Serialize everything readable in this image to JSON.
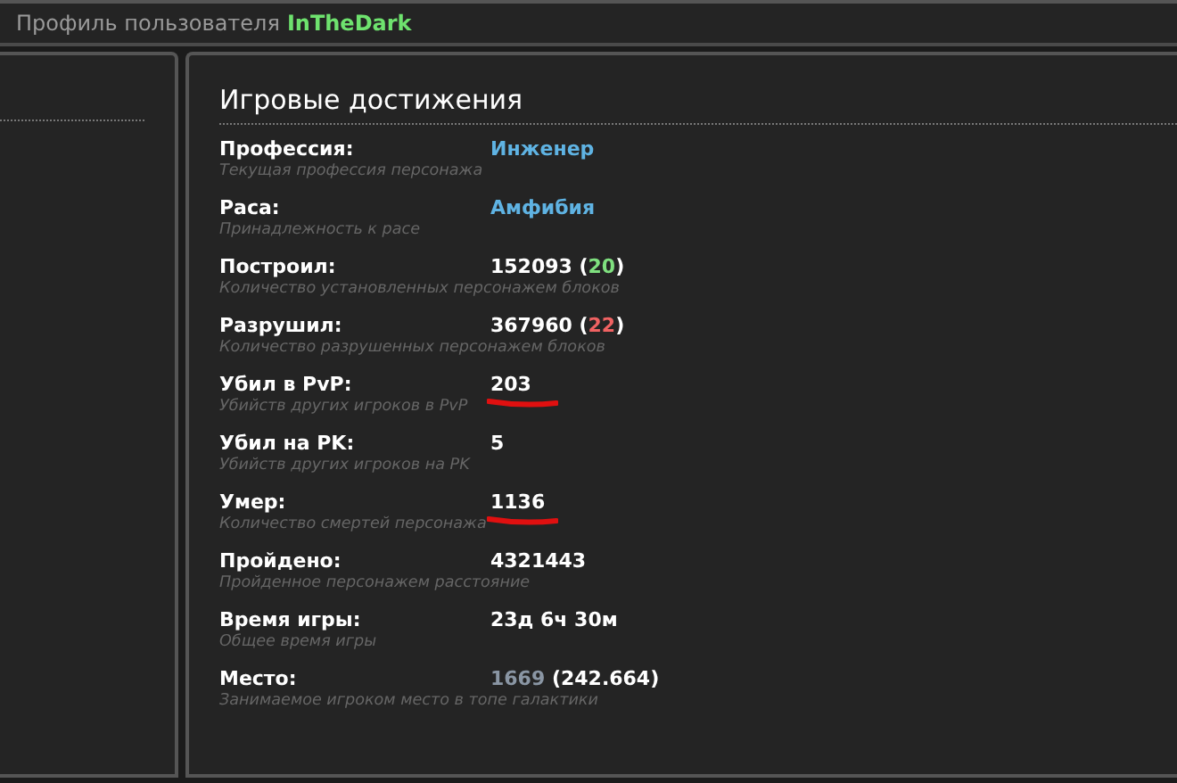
{
  "header": {
    "title": "Профиль пользователя",
    "username": "InTheDark"
  },
  "section": {
    "title": "Игровые достижения",
    "rows": [
      {
        "label": "Профессия:",
        "description": "Текущая профессия персонажа",
        "marked": false,
        "value": [
          {
            "text": "Инженер",
            "color": "#5fb3e3"
          }
        ]
      },
      {
        "label": "Раса:",
        "description": "Принадлежность к расе",
        "marked": false,
        "value": [
          {
            "text": "Амфибия",
            "color": "#5fb3e3"
          }
        ]
      },
      {
        "label": "Построил:",
        "description": "Количество установленных персонажем блоков",
        "marked": false,
        "value": [
          {
            "text": "152093 (",
            "color": "#ffffff"
          },
          {
            "text": "20",
            "color": "#7fe07f"
          },
          {
            "text": ")",
            "color": "#ffffff"
          }
        ]
      },
      {
        "label": "Разрушил:",
        "description": "Количество разрушенных персонажем блоков",
        "marked": false,
        "value": [
          {
            "text": "367960 (",
            "color": "#ffffff"
          },
          {
            "text": "22",
            "color": "#f06262"
          },
          {
            "text": ")",
            "color": "#ffffff"
          }
        ]
      },
      {
        "label": "Убил в PvP:",
        "description": "Убийств других игроков в PvP",
        "marked": true,
        "value": [
          {
            "text": "203",
            "color": "#ffffff"
          }
        ]
      },
      {
        "label": "Убил на PK:",
        "description": "Убийств других игроков на PK",
        "marked": false,
        "value": [
          {
            "text": "5",
            "color": "#ffffff"
          }
        ]
      },
      {
        "label": "Умер:",
        "description": "Количество смертей персонажа",
        "marked": true,
        "value": [
          {
            "text": "1136",
            "color": "#ffffff"
          }
        ]
      },
      {
        "label": "Пройдено:",
        "description": "Пройденное персонажем расстояние",
        "marked": false,
        "value": [
          {
            "text": "4321443",
            "color": "#ffffff"
          }
        ]
      },
      {
        "label": "Время игры:",
        "description": "Общее время игры",
        "marked": false,
        "value": [
          {
            "text": "23д 6ч 30м",
            "color": "#ffffff"
          }
        ]
      },
      {
        "label": "Место:",
        "description": "Занимаемое игроком место в топе галактики",
        "marked": false,
        "value": [
          {
            "text": "1669",
            "color": "#8a96a4"
          },
          {
            "text": " (242.664)",
            "color": "#ffffff"
          }
        ]
      }
    ]
  }
}
